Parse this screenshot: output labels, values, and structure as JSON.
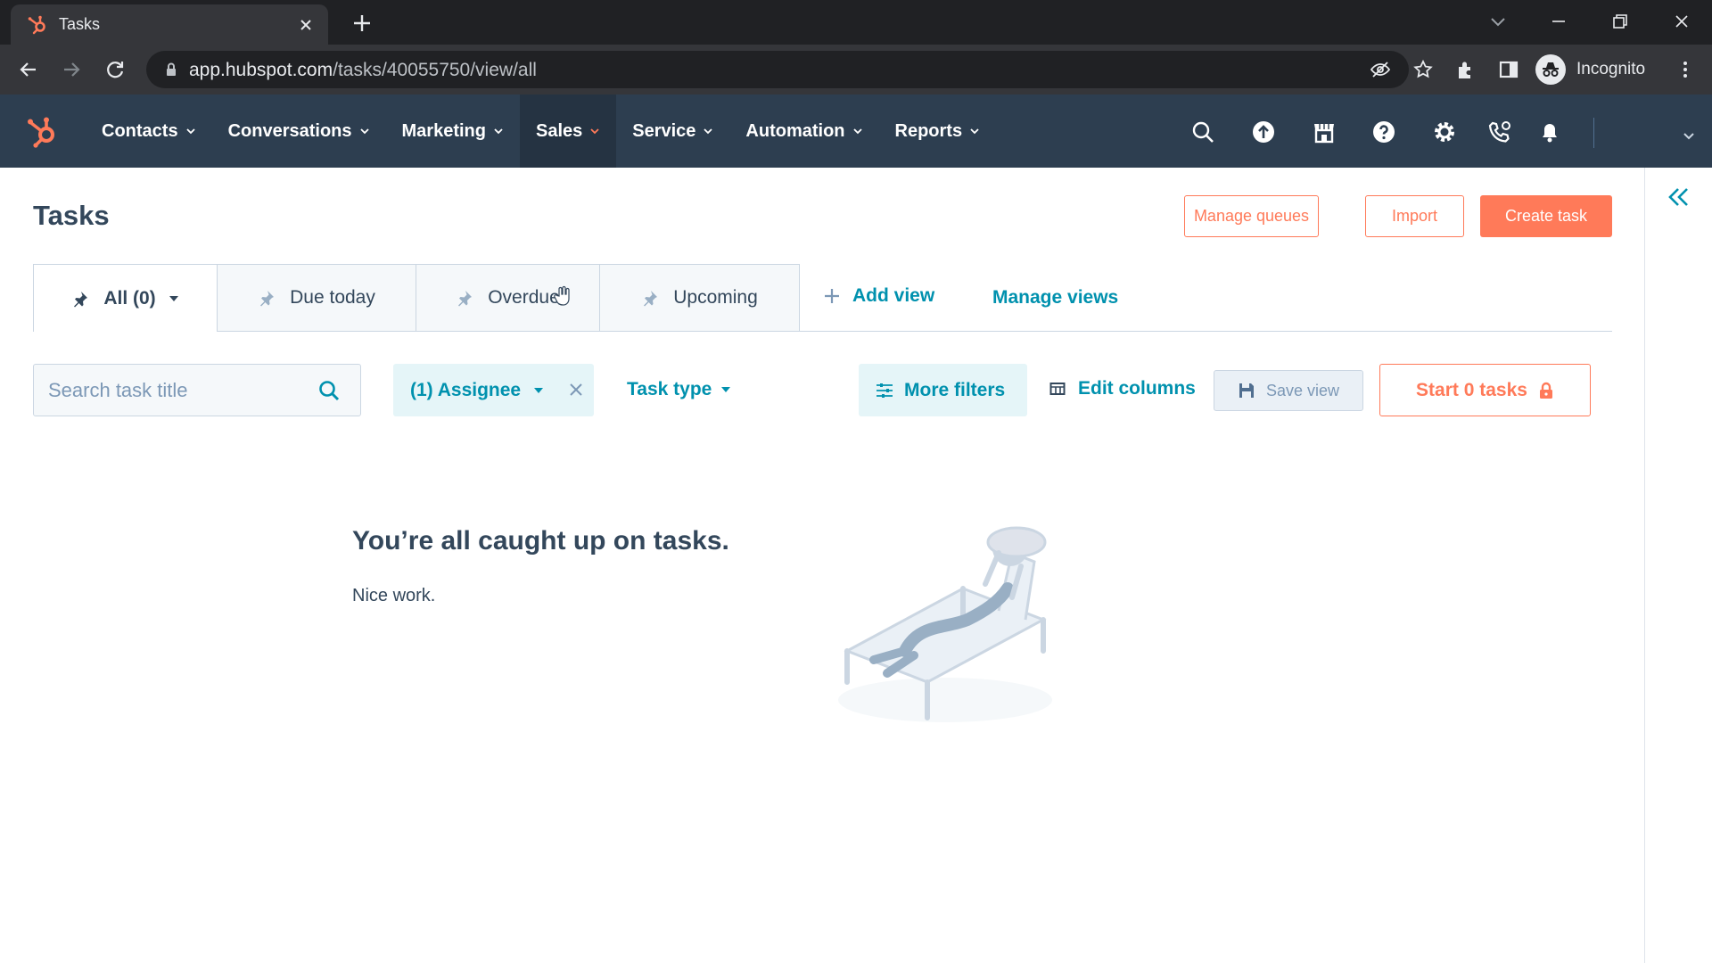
{
  "browser": {
    "tab_title": "Tasks",
    "url_host": "app.hubspot.com",
    "url_path": "/tasks/40055750/view/all",
    "profile_label": "Incognito"
  },
  "nav": {
    "items": [
      {
        "label": "Contacts"
      },
      {
        "label": "Conversations"
      },
      {
        "label": "Marketing"
      },
      {
        "label": "Sales",
        "active": true
      },
      {
        "label": "Service"
      },
      {
        "label": "Automation"
      },
      {
        "label": "Reports"
      }
    ]
  },
  "page": {
    "title": "Tasks",
    "manage_queues": "Manage queues",
    "import": "Import",
    "create_task": "Create task"
  },
  "views": {
    "tabs": [
      {
        "label": "All (0)"
      },
      {
        "label": "Due today"
      },
      {
        "label": "Overdue"
      },
      {
        "label": "Upcoming"
      }
    ],
    "add_view": "Add view",
    "manage_views": "Manage views"
  },
  "filters": {
    "search_placeholder": "Search task title",
    "assignee": "(1) Assignee",
    "task_type": "Task type",
    "more_filters": "More filters",
    "edit_columns": "Edit columns",
    "save_view": "Save view",
    "start_tasks": "Start 0 tasks"
  },
  "empty_state": {
    "title": "You’re all caught up on tasks.",
    "subtitle": "Nice work."
  },
  "colors": {
    "accent": "#ff7a59",
    "link": "#0091ae",
    "nav_bg": "#2d3e50",
    "text": "#33475b"
  }
}
